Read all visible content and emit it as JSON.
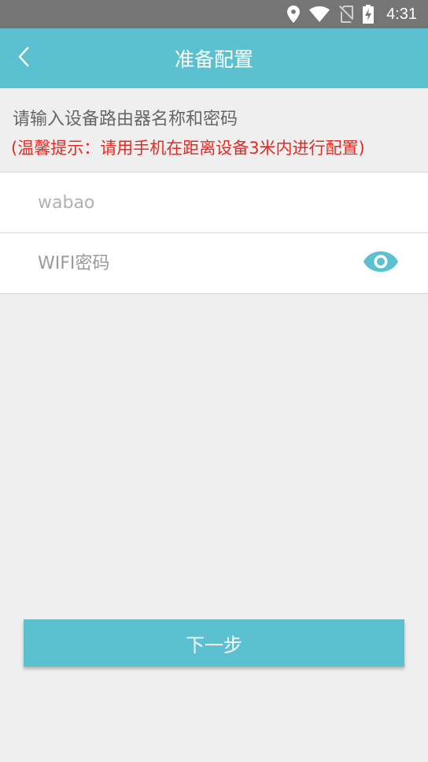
{
  "status_bar": {
    "time": "4:31",
    "icons": [
      "location-icon",
      "wifi-icon",
      "no-sim-icon",
      "battery-charging-icon"
    ]
  },
  "app_bar": {
    "title": "准备配置",
    "back_icon": "chevron-left-icon"
  },
  "content": {
    "prompt": "请输入设备路由器名称和密码",
    "tip": "(温馨提示：请用手机在距离设备3米内进行配置)"
  },
  "form": {
    "ssid_value": "wabao",
    "password_placeholder": "WIFI密码",
    "password_value": "",
    "visibility_icon": "eye-icon"
  },
  "actions": {
    "next_label": "下一步"
  },
  "colors": {
    "accent": "#5bc1d0",
    "status_bar": "#757575",
    "background": "#efefef",
    "tip_text": "#e52a22"
  }
}
